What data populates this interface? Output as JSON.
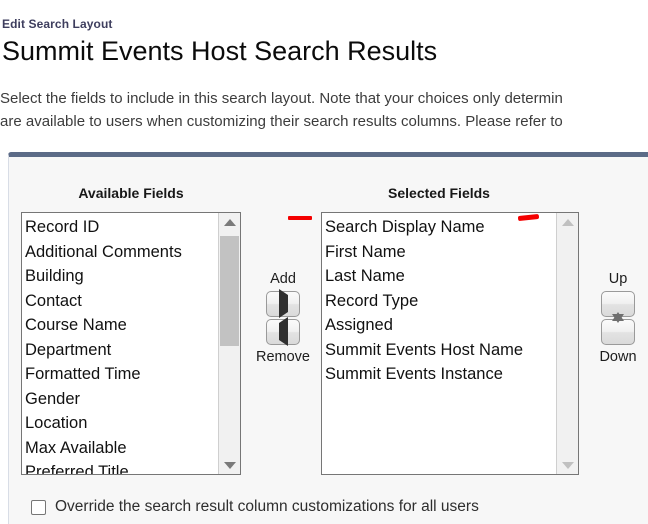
{
  "header": {
    "eyebrow": "Edit Search Layout",
    "title": "Summit Events Host Search Results"
  },
  "description": {
    "line1": "Select the fields to include in this search layout. Note that your choices only determin",
    "line2": "are available to users when customizing their search results columns. Please refer to"
  },
  "panel": {
    "available": {
      "heading": "Available Fields",
      "options": [
        "Record ID",
        "Additional Comments",
        "Building",
        "Contact",
        "Course Name",
        "Department",
        "Formatted Time",
        "Gender",
        "Location",
        "Max Available",
        "Preferred Title"
      ]
    },
    "selected": {
      "heading": "Selected Fields",
      "options": [
        "Search Display Name",
        "First Name",
        "Last Name",
        "Record Type",
        "Assigned",
        "Summit Events Host Name",
        "Summit Events Instance"
      ]
    },
    "transfer_buttons": {
      "add_label": "Add",
      "remove_label": "Remove",
      "add_icon": "triangle-right-icon",
      "remove_icon": "triangle-left-icon"
    },
    "order_buttons": {
      "up_label": "Up",
      "down_label": "Down",
      "up_icon": "triangle-up-icon",
      "down_icon": "triangle-down-icon"
    },
    "override": {
      "label": "Override the search result column customizations for all users",
      "checked": false
    }
  },
  "colors": {
    "panel_top_bar": "#5c6b87",
    "annotation_red": "#f40000",
    "eyebrow_text": "#3e3e5e",
    "panel_background": "#f7f7f7"
  }
}
